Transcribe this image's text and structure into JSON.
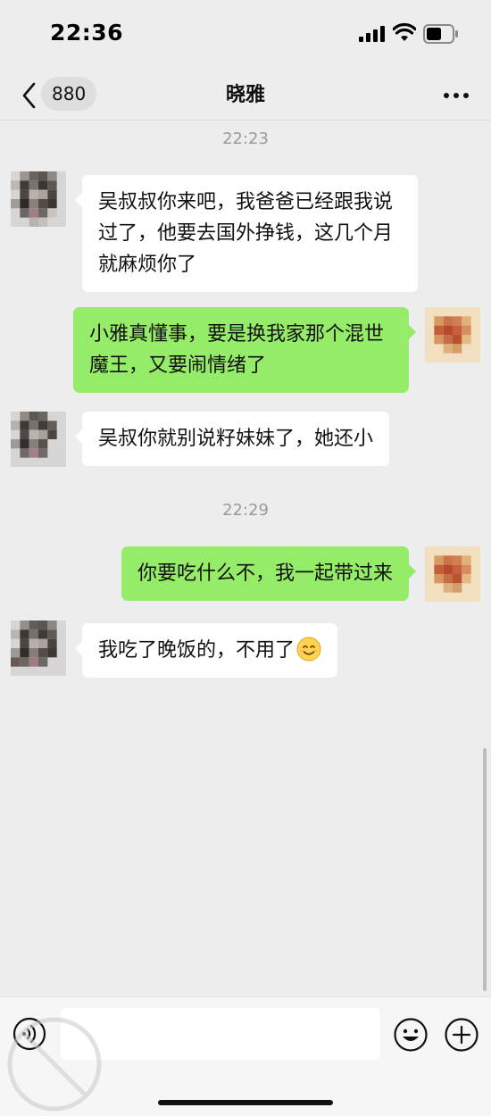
{
  "status_bar": {
    "time": "22:36"
  },
  "nav": {
    "unread_count": "880",
    "title": "晓雅"
  },
  "messages": [
    {
      "type": "time",
      "text": "22:23"
    },
    {
      "type": "incoming",
      "text": "吴叔叔你来吧，我爸爸已经跟我说过了，他要去国外挣钱，这几个月就麻烦你了"
    },
    {
      "type": "outgoing",
      "text": "小雅真懂事，要是换我家那个混世魔王，又要闹情绪了"
    },
    {
      "type": "incoming",
      "text": "吴叔你就别说籽妹妹了，她还小"
    },
    {
      "type": "time",
      "text": "22:29"
    },
    {
      "type": "outgoing",
      "text": "你要吃什么不，我一起带过来"
    },
    {
      "type": "incoming",
      "text": "我吃了晚饭的，不用了"
    }
  ],
  "input": {
    "value": "",
    "placeholder": ""
  },
  "icons": {
    "back": "chevron-left-icon",
    "more": "more-dots-icon",
    "voice": "voice-icon",
    "emoji": "emoji-icon",
    "plus": "plus-icon",
    "smile": "smile-emoji"
  },
  "colors": {
    "background": "#ededed",
    "incoming_bubble": "#ffffff",
    "outgoing_bubble": "#95ec69"
  }
}
